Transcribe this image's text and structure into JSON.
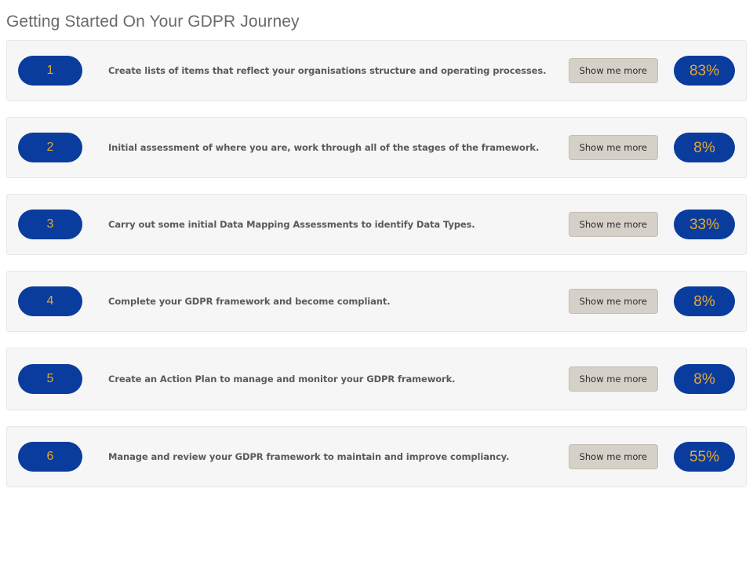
{
  "header": {
    "title": "Getting Started On Your GDPR Journey"
  },
  "colors": {
    "brand_blue": "#0a3c9e",
    "accent_gold": "#e8a92a",
    "card_background": "#f6f6f6",
    "card_border": "#e7e7e7",
    "button_background": "#d6d1c8",
    "button_border": "#c3bdb2",
    "title_text": "#6b6b6b",
    "body_text": "#5a5a5a",
    "page_background": "#ffffff"
  },
  "steps": [
    {
      "number": "1",
      "description": "Create lists of items that reflect your organisations structure and operating processes.",
      "button_label": "Show me more",
      "percent": "83%",
      "percent_value": 83
    },
    {
      "number": "2",
      "description": "Initial assessment of where you are, work through all of the stages of the framework.",
      "button_label": "Show me more",
      "percent": "8%",
      "percent_value": 8
    },
    {
      "number": "3",
      "description": "Carry out some initial Data Mapping Assessments to identify Data Types.",
      "button_label": "Show me more",
      "percent": "33%",
      "percent_value": 33
    },
    {
      "number": "4",
      "description": "Complete your GDPR framework and become compliant.",
      "button_label": "Show me more",
      "percent": "8%",
      "percent_value": 8
    },
    {
      "number": "5",
      "description": "Create an Action Plan to manage and monitor your GDPR framework.",
      "button_label": "Show me more",
      "percent": "8%",
      "percent_value": 8
    },
    {
      "number": "6",
      "description": "Manage and review your GDPR framework to maintain and improve compliancy.",
      "button_label": "Show me more",
      "percent": "55%",
      "percent_value": 55
    }
  ]
}
